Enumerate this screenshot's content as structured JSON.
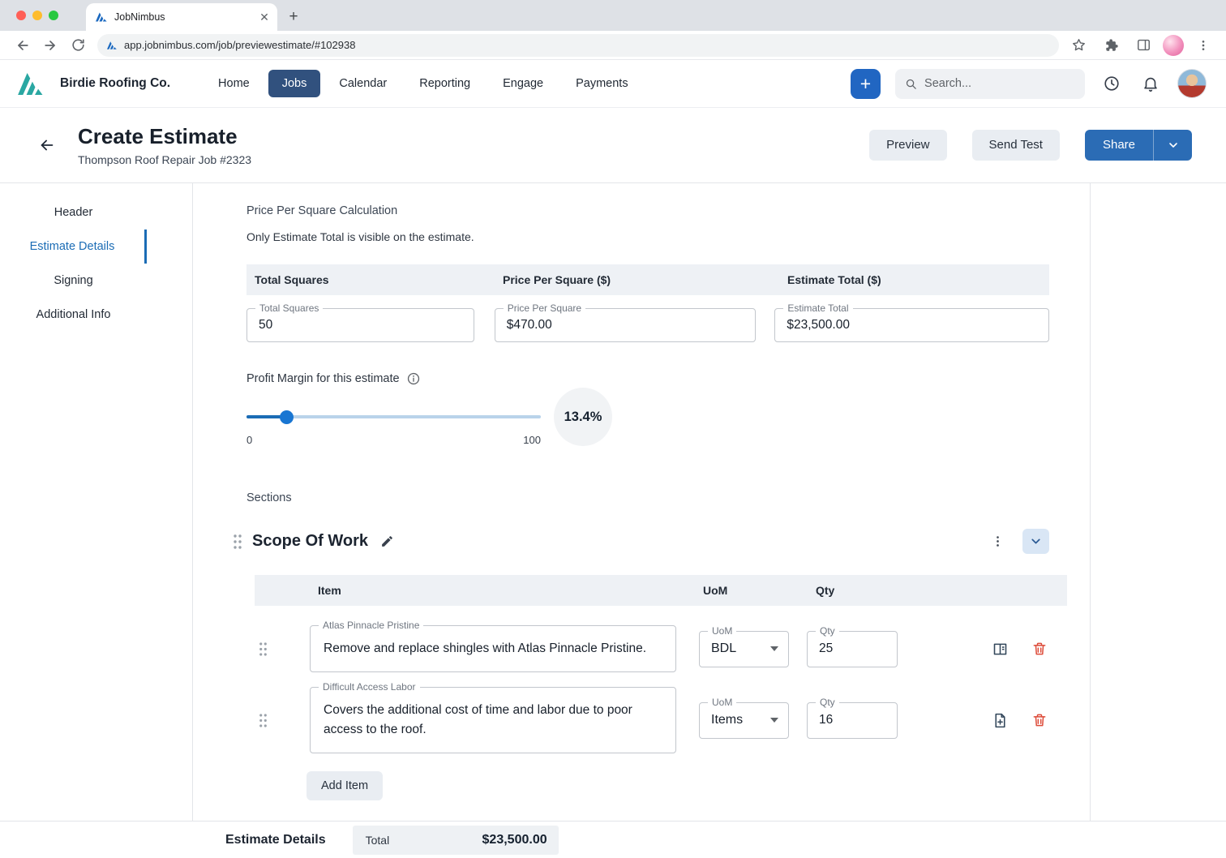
{
  "browser": {
    "tab_title": "JobNimbus",
    "url": "app.jobnimbus.com/job/previewestimate/#102938"
  },
  "app_header": {
    "company": "Birdie Roofing Co.",
    "nav": [
      {
        "label": "Home",
        "active": false
      },
      {
        "label": "Jobs",
        "active": true
      },
      {
        "label": "Calendar",
        "active": false
      },
      {
        "label": "Reporting",
        "active": false
      },
      {
        "label": "Engage",
        "active": false
      },
      {
        "label": "Payments",
        "active": false
      }
    ],
    "search_placeholder": "Search..."
  },
  "page_header": {
    "title": "Create Estimate",
    "subtitle": "Thompson Roof Repair Job #2323",
    "actions": {
      "preview": "Preview",
      "send_test": "Send Test",
      "share": "Share"
    }
  },
  "sidebar": {
    "items": [
      {
        "label": "Header",
        "active": false
      },
      {
        "label": "Estimate Details",
        "active": true
      },
      {
        "label": "Signing",
        "active": false
      },
      {
        "label": "Additional Info",
        "active": false
      }
    ]
  },
  "estimate": {
    "calc": {
      "title": "Price Per Square Calculation",
      "note": "Only Estimate Total is visible on the estimate.",
      "columns": [
        "Total Squares",
        "Price Per Square ($)",
        "Estimate Total ($)"
      ],
      "fields": {
        "total_squares": {
          "label": "Total Squares",
          "value": "50"
        },
        "price_per_square": {
          "label": "Price Per Square",
          "value": "$470.00"
        },
        "estimate_total": {
          "label": "Estimate Total",
          "value": "$23,500.00"
        }
      }
    },
    "profit_margin": {
      "label": "Profit Margin for this estimate",
      "value_pct": 13.4,
      "display": "13.4%",
      "min_label": "0",
      "max_label": "100"
    },
    "sections_label": "Sections",
    "section": {
      "title": "Scope Of Work",
      "columns": [
        "Item",
        "UoM",
        "Qty"
      ],
      "items": [
        {
          "label": "Atlas Pinnacle Pristine",
          "description": "Remove and replace shingles with Atlas Pinnacle Pristine.",
          "uom": "BDL",
          "qty": "25",
          "icon": "book-icon"
        },
        {
          "label": "Difficult Access Labor",
          "description": "Covers the additional cost of time and labor due to poor access to the roof.",
          "uom": "Items",
          "qty": "16",
          "icon": "note-add-icon"
        }
      ],
      "add_item_label": "Add Item"
    }
  },
  "footer": {
    "title": "Estimate Details",
    "total_label": "Total",
    "total_value": "$23,500.00"
  },
  "colors": {
    "accent_blue": "#1b6cb5",
    "nav_active": "#31517e",
    "brand_teal": "#2aa7a2",
    "danger_red": "#dd4b39",
    "strip_gray": "#eef1f5"
  },
  "icons": [
    "search-icon",
    "plus-icon",
    "clock-icon",
    "bell-icon",
    "back-arrow-icon",
    "info-icon",
    "pencil-icon",
    "drag-handle-icon",
    "kebab-icon",
    "chevron-down-icon",
    "book-icon",
    "note-add-icon",
    "trash-icon",
    "star-icon",
    "extensions-icon",
    "panels-icon"
  ]
}
